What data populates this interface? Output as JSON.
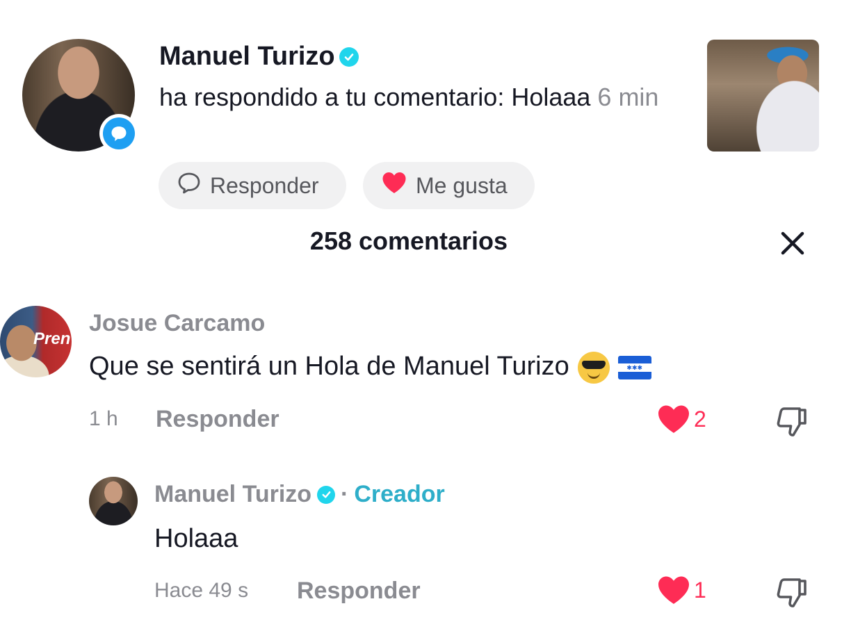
{
  "notification": {
    "user_name": "Manuel Turizo",
    "action_text": "ha respondido a tu comentario: Holaaa",
    "time": "6 min",
    "reply_button_label": "Responder",
    "like_button_label": "Me gusta"
  },
  "comments_header": {
    "title": "258 comentarios"
  },
  "comments": [
    {
      "author": "Josue Carcamo",
      "avatar_text": "Pren",
      "text": "Que se sentirá un Hola de Manuel Turizo",
      "time": "1 h",
      "reply_label": "Responder",
      "likes": "2"
    }
  ],
  "reply": {
    "author": "Manuel Turizo",
    "separator": "·",
    "creator_label": "Creador",
    "text": "Holaaa",
    "time": "Hace 49 s",
    "reply_label": "Responder",
    "likes": "1"
  },
  "colors": {
    "like_red": "#fe2c55",
    "verified_cyan": "#20d5ec",
    "creator_teal": "#2eaec9",
    "muted_gray": "#8a8b91",
    "badge_blue": "#1e9ff2"
  }
}
